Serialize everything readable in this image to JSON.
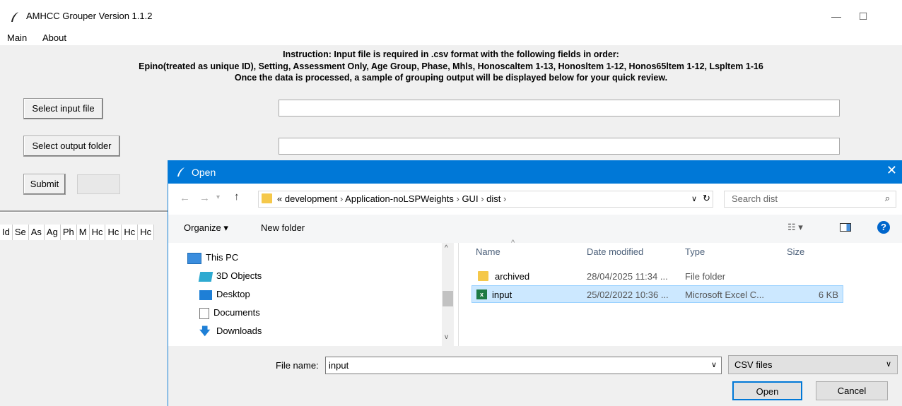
{
  "window": {
    "title": "AMHCC Grouper Version 1.1.2",
    "controls": [
      "—",
      "☐",
      "✕"
    ]
  },
  "menu": {
    "items": [
      "Main",
      "About"
    ]
  },
  "instruction": {
    "line1": "Instruction: Input file is required in .csv format with the following fields in order:",
    "line2": "Epino(treated as unique ID), Setting, Assessment Only, Age Group, Phase, Mhls, Honoscaltem 1-13, Honosltem 1-12, Honos65ltem 1-12, Lspltem 1-16",
    "line3": "Once the data is processed, a sample of grouping output will be displayed below for your quick review."
  },
  "buttons": {
    "select_input": "Select input file",
    "select_output": "Select output folder",
    "submit": "Submit"
  },
  "columns": [
    "Id",
    "Se",
    "As",
    "Ag",
    "Ph",
    "M",
    "Hc",
    "Hc",
    "Hc",
    "Hc"
  ],
  "dialog": {
    "title": "Open",
    "breadcrumb": [
      "«",
      "development",
      "Application-noLSPWeights",
      "GUI",
      "dist"
    ],
    "search_placeholder": "Search dist",
    "organize": "Organize",
    "new_folder": "New folder",
    "nav": [
      "This PC",
      "3D Objects",
      "Desktop",
      "Documents",
      "Downloads"
    ],
    "headers": {
      "name": "Name",
      "date": "Date modified",
      "type": "Type",
      "size": "Size"
    },
    "files": [
      {
        "name": "archived",
        "date": "28/04/2025 11:34 ...",
        "type": "File folder",
        "size": "",
        "icon": "folder-icon",
        "selected": false
      },
      {
        "name": "input",
        "date": "25/02/2022 10:36 ...",
        "type": "Microsoft Excel C...",
        "size": "6 KB",
        "icon": "excel-csv-icon",
        "selected": true
      }
    ],
    "filename_label": "File name:",
    "filename_value": "input",
    "filetype": "CSV files",
    "open": "Open",
    "cancel": "Cancel"
  },
  "colors": {
    "titlebar": "#0078d7",
    "selection": "#cce8ff",
    "help": "#0066cc"
  }
}
